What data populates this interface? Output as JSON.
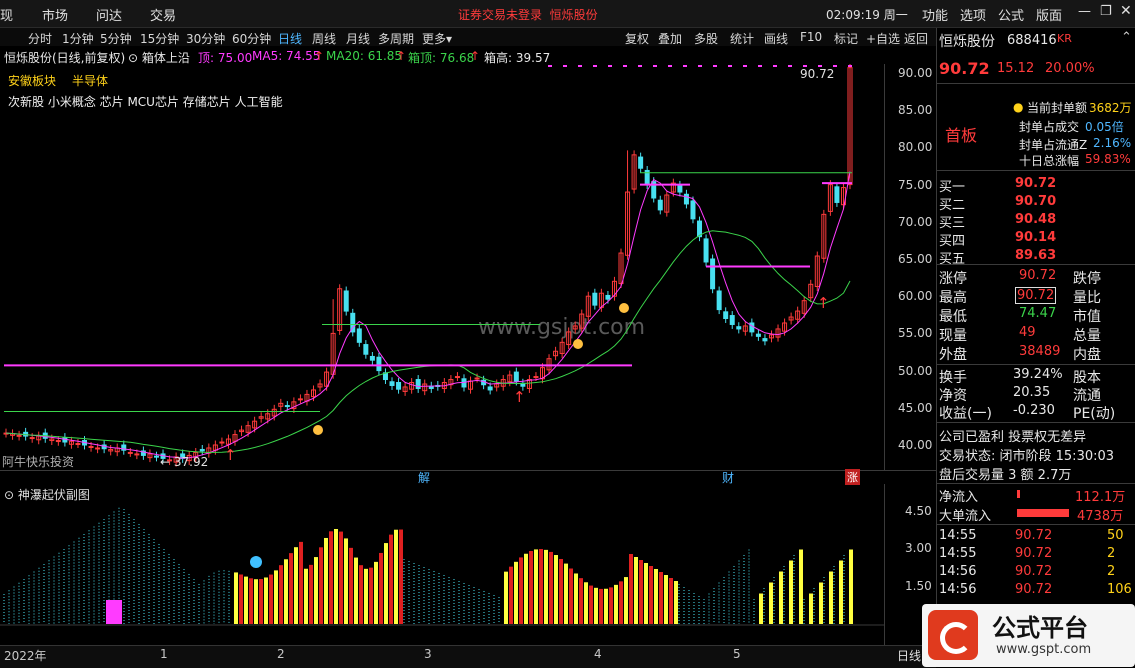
{
  "topbar": {
    "menu": [
      "现",
      "市场",
      "问达",
      "交易"
    ],
    "notice": "证券交易未登录",
    "stock_name": "恒烁股份",
    "clock": "02:09:19 周一",
    "right_menu": [
      "功能",
      "选项",
      "公式",
      "版面"
    ]
  },
  "periods": [
    "分时",
    "1分钟",
    "5分钟",
    "15分钟",
    "30分钟",
    "60分钟",
    "日线",
    "周线",
    "月线",
    "多周期",
    "更多"
  ],
  "active_period": "日线",
  "tools": [
    "复权",
    "叠加",
    "多股",
    "统计",
    "画线",
    "F10",
    "标记",
    "+自选",
    "返回"
  ],
  "info": {
    "title": "恒烁股份(日线,前复权)",
    "indicator": "箱体上沿",
    "top": "顶: 75.00",
    "ma5": "MA5: 74.55",
    "ma20": "MA20: 61.85",
    "box_top": "箱顶: 76.68",
    "box_h": "箱高: 39.57"
  },
  "sector": "安徽板块",
  "industry": "半导体",
  "concepts": "次新股 小米概念 芯片 MCU芯片 存储芯片 人工智能",
  "main_axis": [
    "90.00",
    "85.00",
    "80.00",
    "75.00",
    "70.00",
    "65.00",
    "60.00",
    "55.00",
    "50.00",
    "45.00",
    "40.00"
  ],
  "sub_axis": [
    "4.50",
    "3.00",
    "1.50"
  ],
  "annotations": {
    "high": "90.72",
    "low": "37.92",
    "watermark": "www.gsjpt.com",
    "brand": "阿牛快乐投资",
    "mark_jie": "解",
    "mark_cai": "财",
    "mark_zhang": "涨"
  },
  "subchart_title": "神瀑起伏副图",
  "xaxis": [
    "2022年",
    "1",
    "2",
    "3",
    "4",
    "5"
  ],
  "bottom_period": "日线",
  "panel": {
    "name": "恒烁股份",
    "code": "688416",
    "kr": "KR",
    "price": "90.72",
    "change": "15.12",
    "pct": "20.00%",
    "board": "首板",
    "seal_amount_label": "当前封单额",
    "seal_amount": "3682万",
    "seal_ratio_label": "封单占成交",
    "seal_ratio": "0.05倍",
    "seal_float_label": "封单占流通Z",
    "seal_float": "2.16%",
    "ten_day_label": "十日总涨幅",
    "ten_day": "59.83%",
    "bids": [
      {
        "label": "买一",
        "price": "90.72"
      },
      {
        "label": "买二",
        "price": "90.70"
      },
      {
        "label": "买三",
        "price": "90.48"
      },
      {
        "label": "买四",
        "price": "90.14"
      },
      {
        "label": "买五",
        "price": "89.63"
      }
    ],
    "stats": [
      {
        "l": "涨停",
        "v": "90.72",
        "r": "跌停"
      },
      {
        "l": "最高",
        "v": "90.72",
        "r": "量比"
      },
      {
        "l": "最低",
        "v": "74.47",
        "r": "市值"
      },
      {
        "l": "现量",
        "v": "49",
        "r": "总量"
      },
      {
        "l": "外盘",
        "v": "38489",
        "r": "内盘"
      }
    ],
    "stats2": [
      {
        "l": "换手",
        "v": "39.24%",
        "r": "股本"
      },
      {
        "l": "净资",
        "v": "20.35",
        "r": "流通"
      },
      {
        "l": "收益(一)",
        "v": "-0.230",
        "r": "PE(动)"
      }
    ],
    "note1": "公司已盈利 投票权无差异",
    "note2": "交易状态: 闭市阶段 15:30:03",
    "note3": "盘后交易量 3 额 2.7万",
    "net_in_label": "净流入",
    "net_in": "112.1万",
    "big_in_label": "大单流入",
    "big_in": "4738万",
    "ticks": [
      {
        "t": "14:55",
        "p": "90.72",
        "v": "50"
      },
      {
        "t": "14:55",
        "p": "90.72",
        "v": "2"
      },
      {
        "t": "14:56",
        "p": "90.72",
        "v": "2"
      },
      {
        "t": "14:56",
        "p": "90.72",
        "v": "106"
      }
    ]
  },
  "logo": {
    "text": "公式平台",
    "url": "www.gspt.com"
  },
  "colors": {
    "up": "#ff3b3b",
    "down": "#48e0f0",
    "ma5": "#ff3bff",
    "ma20": "#3bd44b",
    "box": "#ff3bff"
  }
}
